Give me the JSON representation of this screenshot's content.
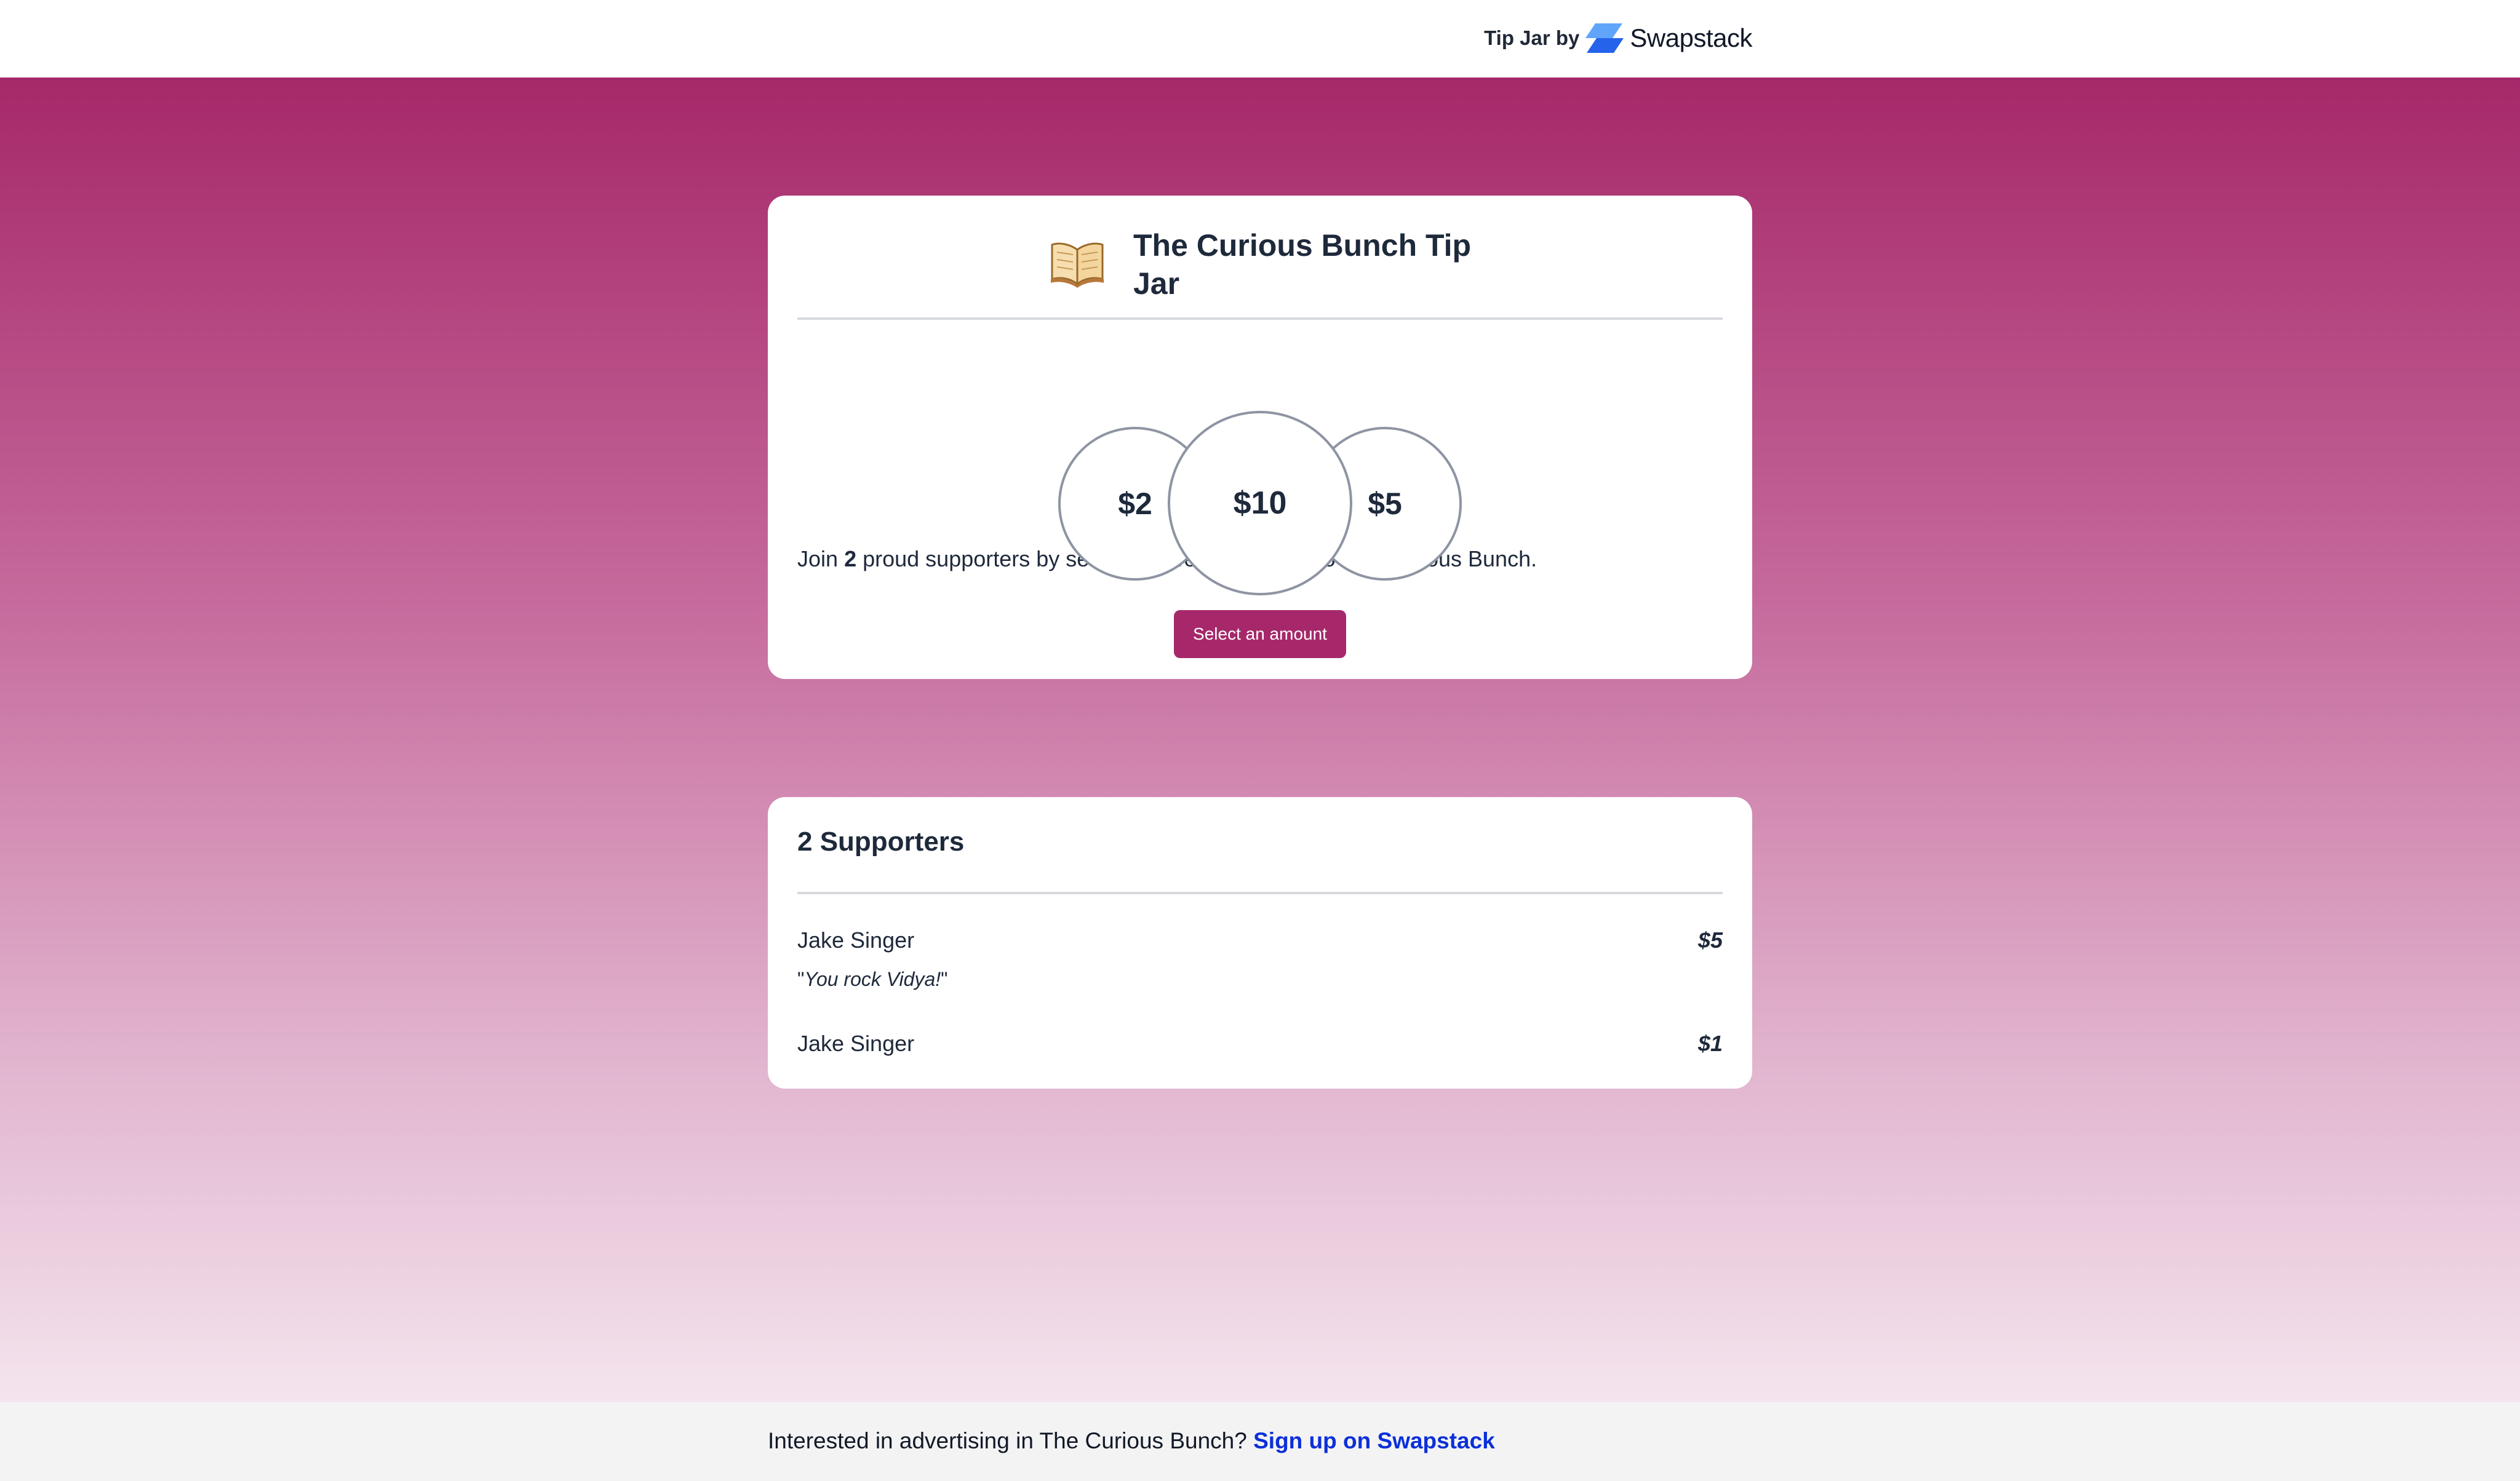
{
  "header": {
    "brand_prefix": "Tip Jar by",
    "brand_name": "Swapstack",
    "logo_icon": "swapstack-logo-icon"
  },
  "tip_jar": {
    "icon": "open-book-icon",
    "title": "The Curious Bunch Tip Jar",
    "description_prefix": "Join",
    "supporter_count": "2",
    "description_suffix": "proud supporters by sending a well earned tip to The Curious Bunch.",
    "amounts": {
      "left": "$2",
      "center": "$10",
      "right": "$5"
    },
    "select_button_label": "Select an amount"
  },
  "supporters": {
    "title": "2 Supporters",
    "list": [
      {
        "name": "Jake Singer",
        "amount": "$5",
        "message": "You rock Vidya!"
      },
      {
        "name": "Jake Singer",
        "amount": "$1",
        "message": ""
      }
    ]
  },
  "footer": {
    "text": "Interested in advertising in The Curious Bunch?",
    "link_label": "Sign up on Swapstack"
  },
  "colors": {
    "accent": "#a6286a",
    "link": "#0b2fd9",
    "text": "#1e293b"
  }
}
